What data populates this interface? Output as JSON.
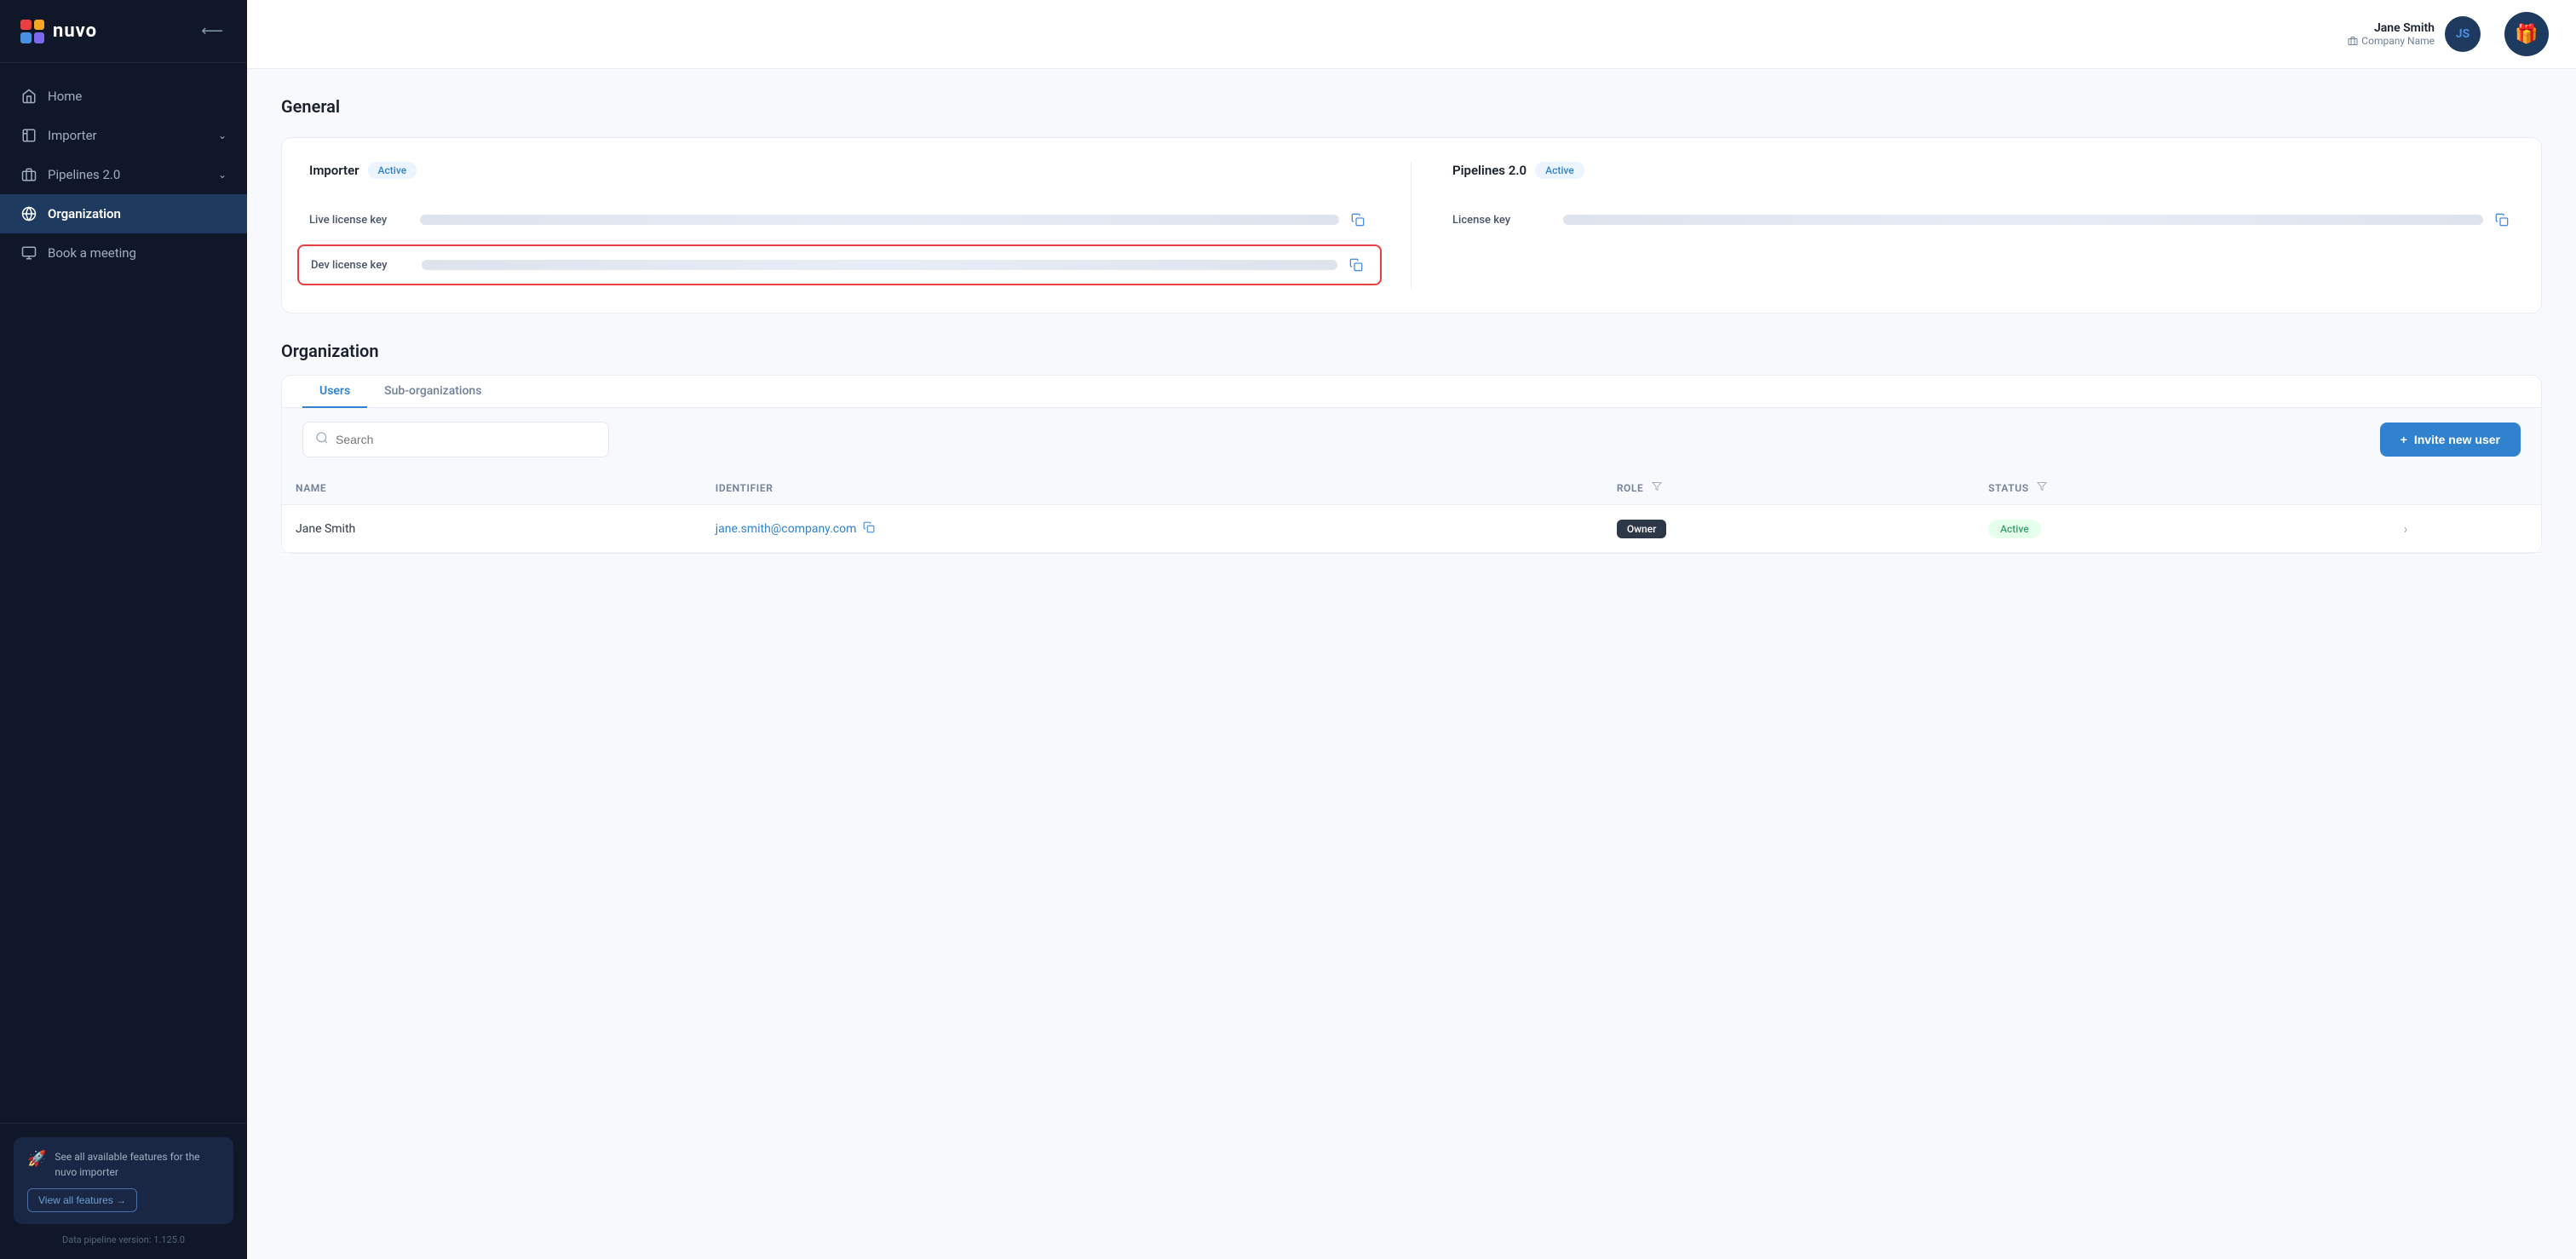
{
  "app": {
    "name": "nuvo",
    "version": "Data pipeline version: 1.125.0"
  },
  "sidebar": {
    "collapse_label": "←",
    "nav_items": [
      {
        "id": "home",
        "label": "Home",
        "icon": "home-icon",
        "active": false
      },
      {
        "id": "importer",
        "label": "Importer",
        "icon": "importer-icon",
        "has_chevron": true,
        "active": false
      },
      {
        "id": "pipelines",
        "label": "Pipelines 2.0",
        "icon": "pipelines-icon",
        "has_chevron": true,
        "active": false
      },
      {
        "id": "organization",
        "label": "Organization",
        "icon": "org-icon",
        "active": true
      },
      {
        "id": "booking",
        "label": "Book a meeting",
        "icon": "booking-icon",
        "active": false
      }
    ],
    "feature_card": {
      "title": "See all available features for the nuvo importer",
      "button_label": "View all features →"
    }
  },
  "topbar": {
    "user_name": "Jane Smith",
    "user_company": "Company Name",
    "user_initials": "JS",
    "gift_icon": "gift-icon"
  },
  "general": {
    "section_title": "General",
    "importer": {
      "title": "Importer",
      "status": "Active",
      "live_key_label": "Live license key",
      "dev_key_label": "Dev license key"
    },
    "pipelines": {
      "title": "Pipelines 2.0",
      "status": "Active",
      "key_label": "License key"
    }
  },
  "organization": {
    "section_title": "Organization",
    "tabs": [
      {
        "id": "users",
        "label": "Users",
        "active": true
      },
      {
        "id": "sub-orgs",
        "label": "Sub-organizations",
        "active": false
      }
    ],
    "search_placeholder": "Search",
    "invite_button_label": "Invite new user",
    "table": {
      "columns": [
        {
          "id": "name",
          "label": "Name"
        },
        {
          "id": "identifier",
          "label": "Identifier"
        },
        {
          "id": "role",
          "label": "Role"
        },
        {
          "id": "status",
          "label": "Status"
        }
      ],
      "rows": [
        {
          "name": "Jane Smith",
          "identifier": "jane.smith@company.com",
          "role": "Owner",
          "status": "Active"
        }
      ]
    }
  }
}
